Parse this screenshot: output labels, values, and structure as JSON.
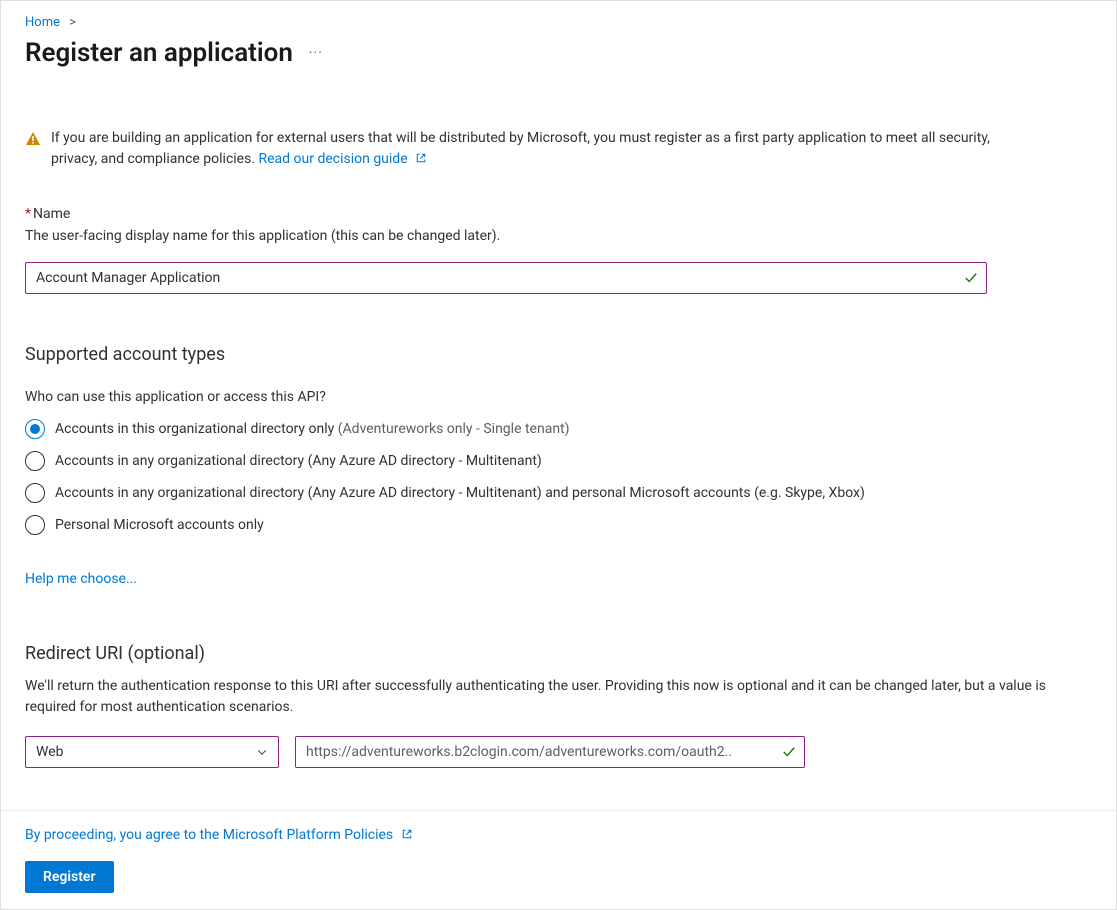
{
  "breadcrumb": {
    "home": "Home"
  },
  "page": {
    "title": "Register an application"
  },
  "banner": {
    "text": "If you are building an application for external users that will be distributed by Microsoft, you must register as a first party application to meet all security, privacy, and compliance policies. ",
    "link": "Read our decision guide"
  },
  "nameField": {
    "label": "Name",
    "desc": "The user-facing display name for this application (this can be changed later).",
    "value": "Account Manager Application"
  },
  "accountTypes": {
    "title": "Supported account types",
    "question": "Who can use this application or access this API?",
    "options": [
      {
        "label": "Accounts in this organizational directory only ",
        "suffix": "(Adventureworks only - Single tenant)",
        "selected": true
      },
      {
        "label": "Accounts in any organizational directory (Any Azure AD directory - Multitenant)",
        "suffix": "",
        "selected": false
      },
      {
        "label": "Accounts in any organizational directory (Any Azure AD directory - Multitenant) and personal Microsoft accounts (e.g. Skype, Xbox)",
        "suffix": "",
        "selected": false
      },
      {
        "label": "Personal Microsoft accounts only",
        "suffix": "",
        "selected": false
      }
    ],
    "helpLink": "Help me choose..."
  },
  "redirect": {
    "title": "Redirect URI (optional)",
    "desc": "We'll return the authentication response to this URI after successfully authenticating the user. Providing this now is optional and it can be changed later, but a value is required for most authentication scenarios.",
    "platform": "Web",
    "uri": "https://adventureworks.b2clogin.com/adventureworks.com/oauth2.."
  },
  "footer": {
    "policy": "By proceeding, you agree to the Microsoft Platform Policies",
    "registerBtn": "Register"
  }
}
